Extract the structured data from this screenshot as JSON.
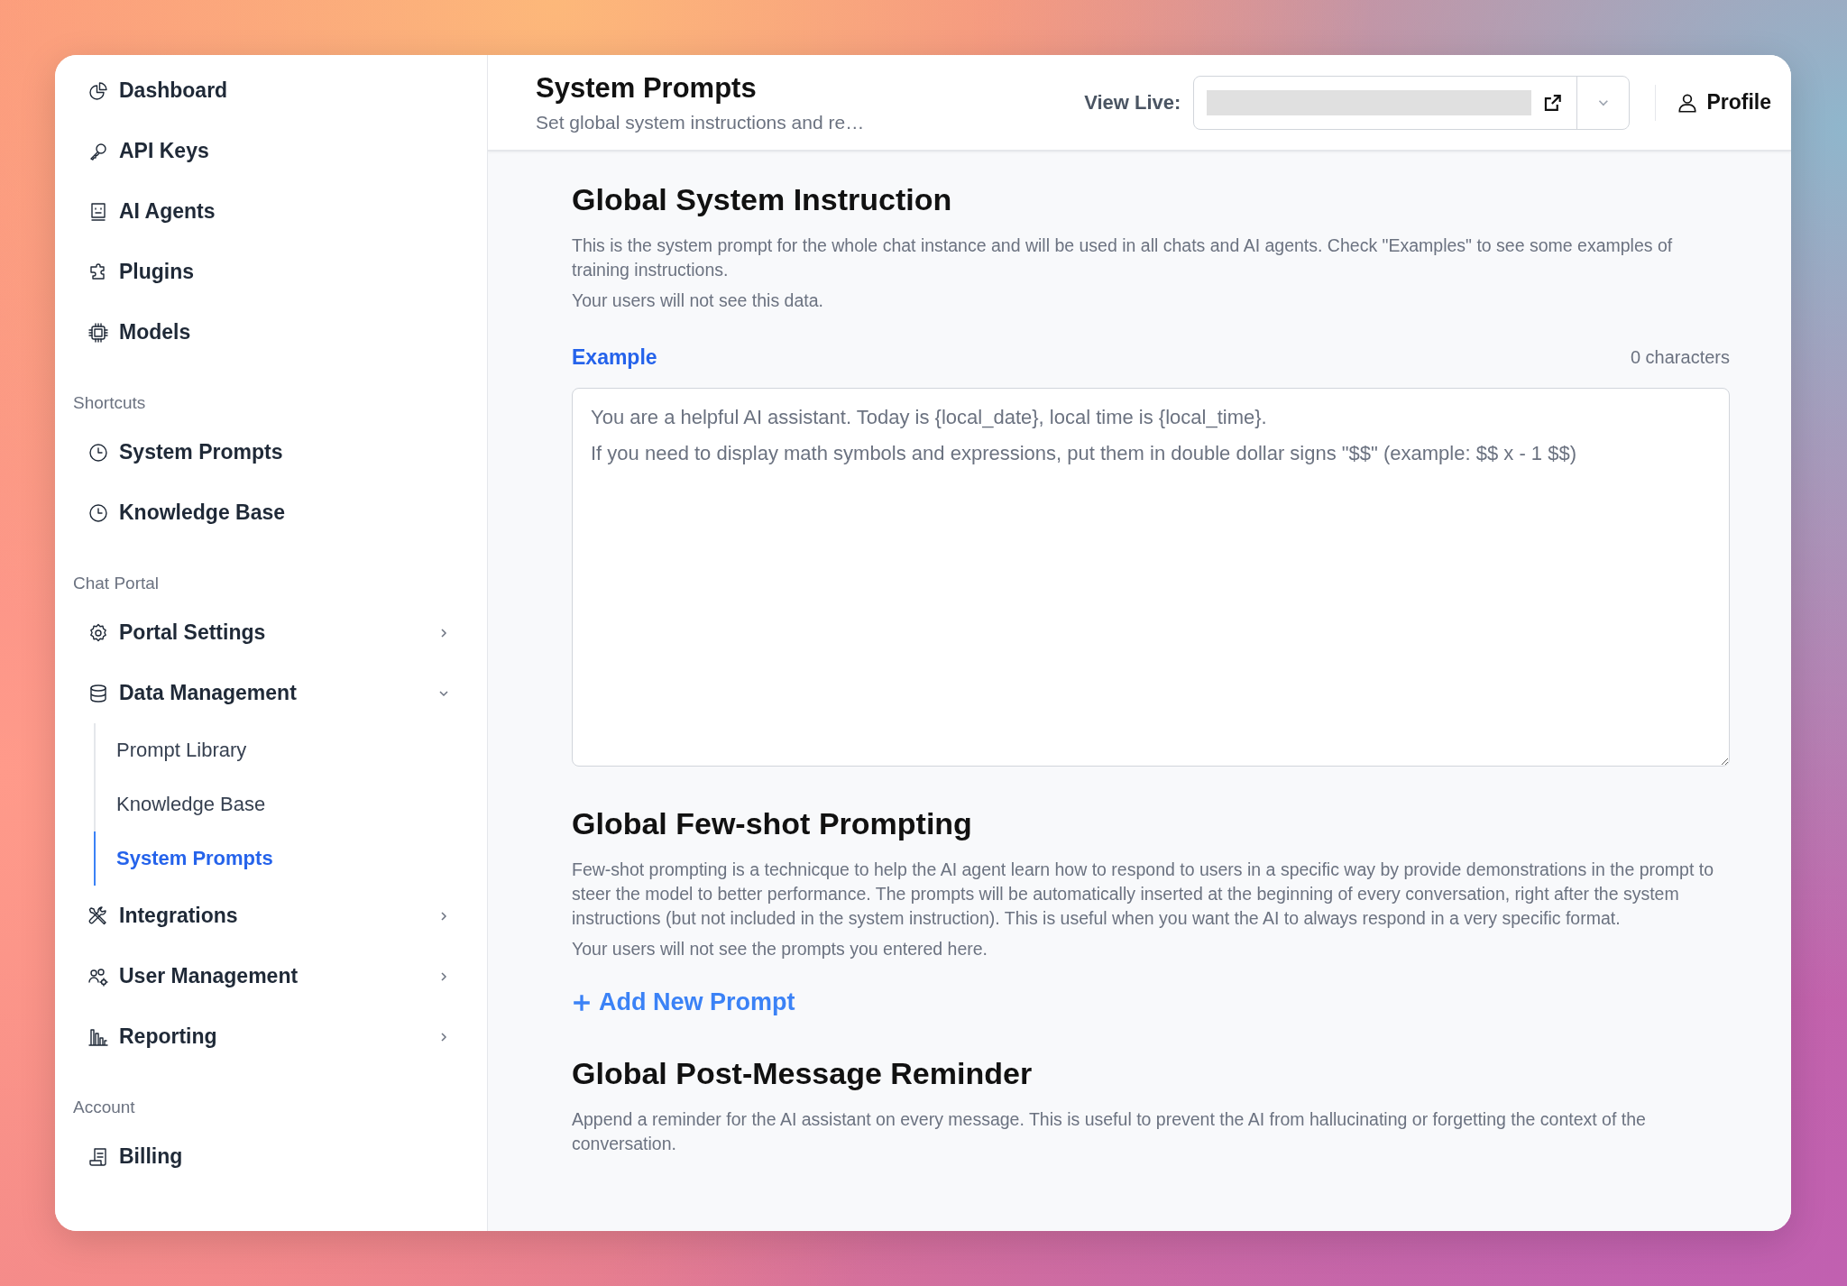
{
  "sidebar": {
    "groups": [
      {
        "items": [
          {
            "label": "Dashboard",
            "selected": false
          },
          {
            "label": "API Keys",
            "selected": false
          },
          {
            "label": "AI Agents",
            "selected": false
          },
          {
            "label": "Plugins",
            "selected": false
          },
          {
            "label": "Models",
            "selected": false
          }
        ]
      },
      {
        "heading": "Shortcuts",
        "items": [
          {
            "label": "System Prompts",
            "selected": false
          },
          {
            "label": "Knowledge Base",
            "selected": false
          }
        ]
      },
      {
        "heading": "Chat Portal",
        "items": [
          {
            "label": "Portal Settings",
            "selected": false,
            "expanded": false
          },
          {
            "label": "Data Management",
            "selected": false,
            "expanded": true,
            "children": [
              {
                "label": "Prompt Library",
                "selected": false
              },
              {
                "label": "Knowledge Base",
                "selected": false
              },
              {
                "label": "System Prompts",
                "selected": true
              }
            ]
          },
          {
            "label": "Integrations",
            "selected": false,
            "expanded": false
          },
          {
            "label": "User Management",
            "selected": false,
            "expanded": false
          },
          {
            "label": "Reporting",
            "selected": false,
            "expanded": false
          }
        ]
      },
      {
        "heading": "Account",
        "items": [
          {
            "label": "Billing",
            "selected": false
          }
        ]
      }
    ]
  },
  "header": {
    "title": "System Prompts",
    "subtitle": "Set global system instructions and re…",
    "view_live_label": "View Live:",
    "profile": "Profile"
  },
  "sections": [
    {
      "kind": "instruction",
      "title": "Global System Instruction",
      "paragraphs": [
        "This is the system prompt for the whole chat instance and will be used in all chats and AI agents. Check \"Examples\" to see some examples of training instructions.",
        "Your users will not see this data."
      ],
      "example_link": "Example",
      "char_count": "0 characters",
      "placeholder": "You are a helpful AI assistant. Today is {local_date}, local time is {local_time}.\nIf you need to display math symbols and expressions, put them in double dollar signs \"$$\" (example: $$ x - 1 $$)"
    },
    {
      "kind": "fewshot",
      "title": "Global Few-shot Prompting",
      "paragraphs": [
        "Few-shot prompting is a technicque to help the AI agent learn how to respond to users in a specific way by provide demonstrations in the prompt to steer the model to better performance. The prompts will be automatically inserted at the beginning of every conversation, right after the system instructions (but not included in the system instruction). This is useful when you want the AI to always respond in a very specific format.",
        "Your users will not see the prompts you entered here."
      ],
      "add_button": "Add New Prompt"
    },
    {
      "kind": "reminder",
      "title": "Global Post-Message Reminder",
      "paragraphs": [
        "Append a reminder for the AI assistant on every message. This is useful to prevent the AI from hallucinating or forgetting the context of the conversation."
      ]
    }
  ]
}
